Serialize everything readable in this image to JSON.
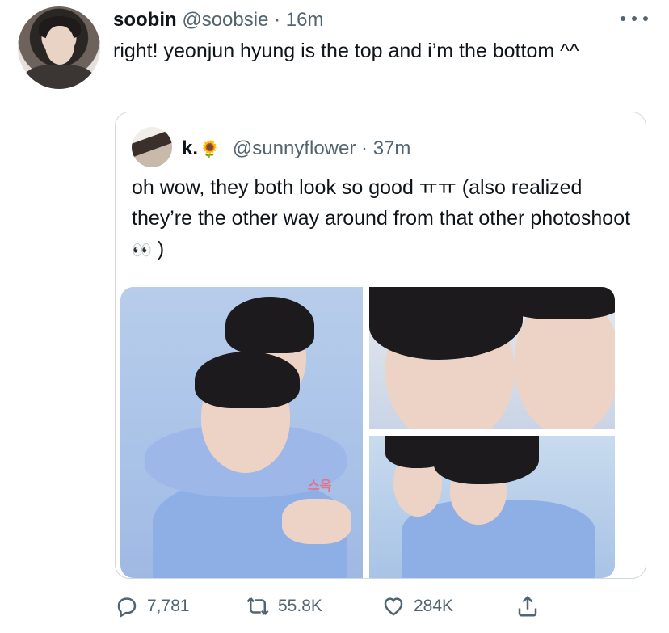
{
  "tweet": {
    "author_name": "soobin",
    "author_handle": "@soobsie",
    "separator": "·",
    "time": "16m",
    "text": "right! yeonjun hyung is the top and i’m the bottom ^^"
  },
  "quoted_tweet": {
    "author_name": "k.",
    "author_emoji": "🌻",
    "author_handle": "@sunnyflower",
    "separator": "·",
    "time": "37m",
    "text_main": "oh wow, they both look so good ㅠㅠ (also realized they’re the other way around from that other photoshoot",
    "text_emoji": "👀",
    "text_end": ")",
    "sticker_text": "스윽"
  },
  "actions": {
    "replies": "7,781",
    "retweets": "55.8K",
    "likes": "284K"
  },
  "icons": {
    "more": "more-horizontal-icon",
    "reply": "reply-icon",
    "retweet": "retweet-icon",
    "like": "heart-icon",
    "share": "share-icon"
  },
  "colors": {
    "text_primary": "#0f1419",
    "text_secondary": "#536471",
    "border": "#cfd9de"
  }
}
